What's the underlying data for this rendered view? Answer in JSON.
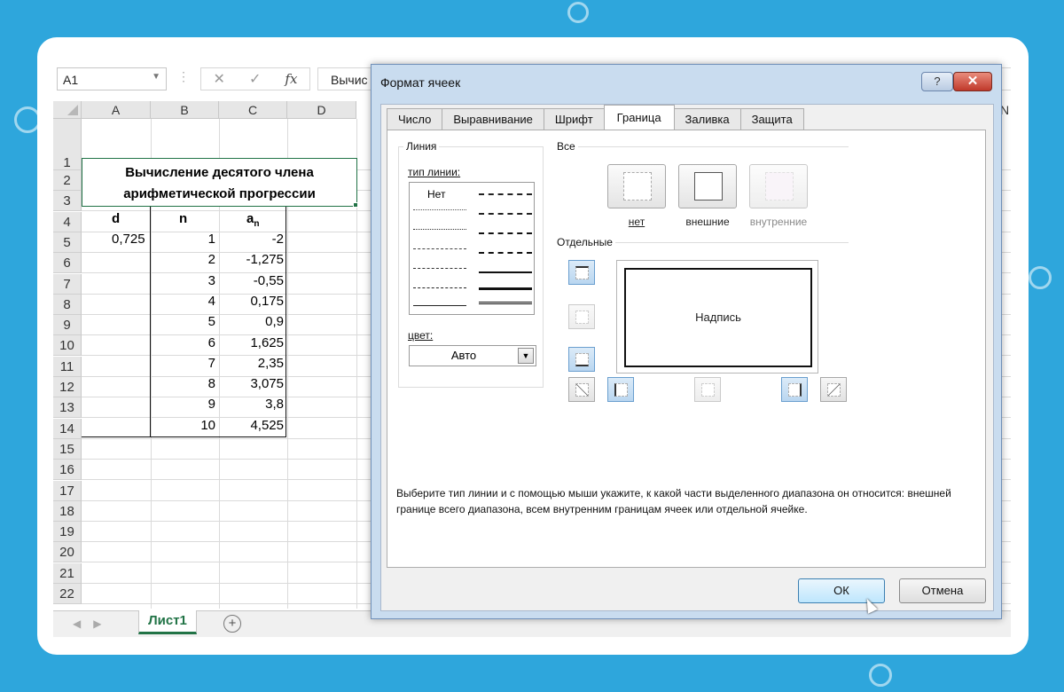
{
  "formula_bar": {
    "name_box": "A1",
    "fx_label": "fx",
    "formula_text": "Вычис"
  },
  "sheet": {
    "columns": [
      "A",
      "B",
      "C",
      "D"
    ],
    "rows": [
      "1",
      "2",
      "3",
      "4",
      "5",
      "6",
      "7",
      "8",
      "9",
      "10",
      "11",
      "12",
      "13",
      "14",
      "15",
      "16",
      "17",
      "18",
      "19",
      "20",
      "21",
      "22"
    ],
    "title_line1": "Вычисление десятого  члена",
    "title_line2": "арифметической прогрессии",
    "header": {
      "d": "d",
      "n": "n",
      "a": "a",
      "a_sub": "n"
    },
    "d_value": "0,725",
    "data_rows": [
      {
        "n": "1",
        "a": "-2"
      },
      {
        "n": "2",
        "a": "-1,275"
      },
      {
        "n": "3",
        "a": "-0,55"
      },
      {
        "n": "4",
        "a": "0,175"
      },
      {
        "n": "5",
        "a": "0,9"
      },
      {
        "n": "6",
        "a": "1,625"
      },
      {
        "n": "7",
        "a": "2,35"
      },
      {
        "n": "8",
        "a": "3,075"
      },
      {
        "n": "9",
        "a": "3,8"
      },
      {
        "n": "10",
        "a": "4,525"
      }
    ],
    "sheet_tab": "Лист1",
    "add_sheet": "+",
    "edge_letter": "N"
  },
  "dialog": {
    "title": "Формат ячеек",
    "help_label": "?",
    "close_label": "✕",
    "tabs": [
      "Число",
      "Выравнивание",
      "Шрифт",
      "Граница",
      "Заливка",
      "Защита"
    ],
    "active_tab": "Граница",
    "line_group": "Линия",
    "line_type_label": "тип линии:",
    "line_none": "Нет",
    "color_label": "цвет:",
    "color_value": "Авто",
    "all_group": "Все",
    "preset_none": "нет",
    "preset_outer": "внешние",
    "preset_inner": "внутренние",
    "separate_group": "Отдельные",
    "preview_caption": "Надпись",
    "hint": "Выберите тип линии и с помощью мыши укажите, к какой части выделенного диапазона он относится: внешней границе всего диапазона, всем внутренним границам ячеек или отдельной ячейке.",
    "ok_label": "ОК",
    "cancel_label": "Отмена"
  }
}
